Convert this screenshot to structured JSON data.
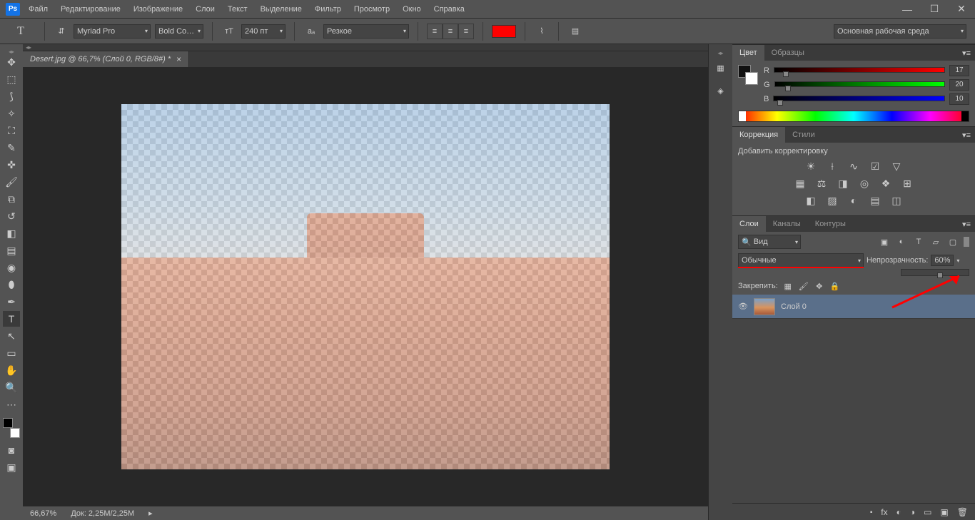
{
  "menu": {
    "file": "Файл",
    "edit": "Редактирование",
    "image": "Изображение",
    "layer": "Слои",
    "type": "Текст",
    "select": "Выделение",
    "filter": "Фильтр",
    "view": "Просмотр",
    "window": "Окно",
    "help": "Справка"
  },
  "opt": {
    "tool_glyph": "T",
    "font": "Myriad Pro",
    "weight": "Bold Co…",
    "size": "240 пт",
    "aa": "Резкое",
    "workspace": "Основная рабочая среда"
  },
  "doc": {
    "tab": "Desert.jpg @ 66,7% (Слой 0, RGB/8#) *"
  },
  "status": {
    "zoom": "66,67%",
    "doc": "Док: 2,25M/2,25M"
  },
  "color": {
    "tab_color": "Цвет",
    "tab_swatches": "Образцы",
    "r_label": "R",
    "g_label": "G",
    "b_label": "B",
    "r": "17",
    "g": "20",
    "b": "10"
  },
  "adjust": {
    "tab_adjust": "Коррекция",
    "tab_styles": "Стили",
    "add_label": "Добавить корректировку"
  },
  "layers": {
    "tab_layers": "Слои",
    "tab_channels": "Каналы",
    "tab_paths": "Контуры",
    "filter_kind": "Вид",
    "blend": "Обычные",
    "opacity_label": "Непрозрачность:",
    "opacity_value": "60%",
    "lock_label": "Закрепить:",
    "layer0": "Слой 0"
  },
  "icons": {
    "search": "🔍",
    "link": "⬝",
    "fx": "fx",
    "mask": "◐",
    "folder": "▭",
    "new": "▣",
    "trash": "🗑",
    "eye": "👁"
  }
}
